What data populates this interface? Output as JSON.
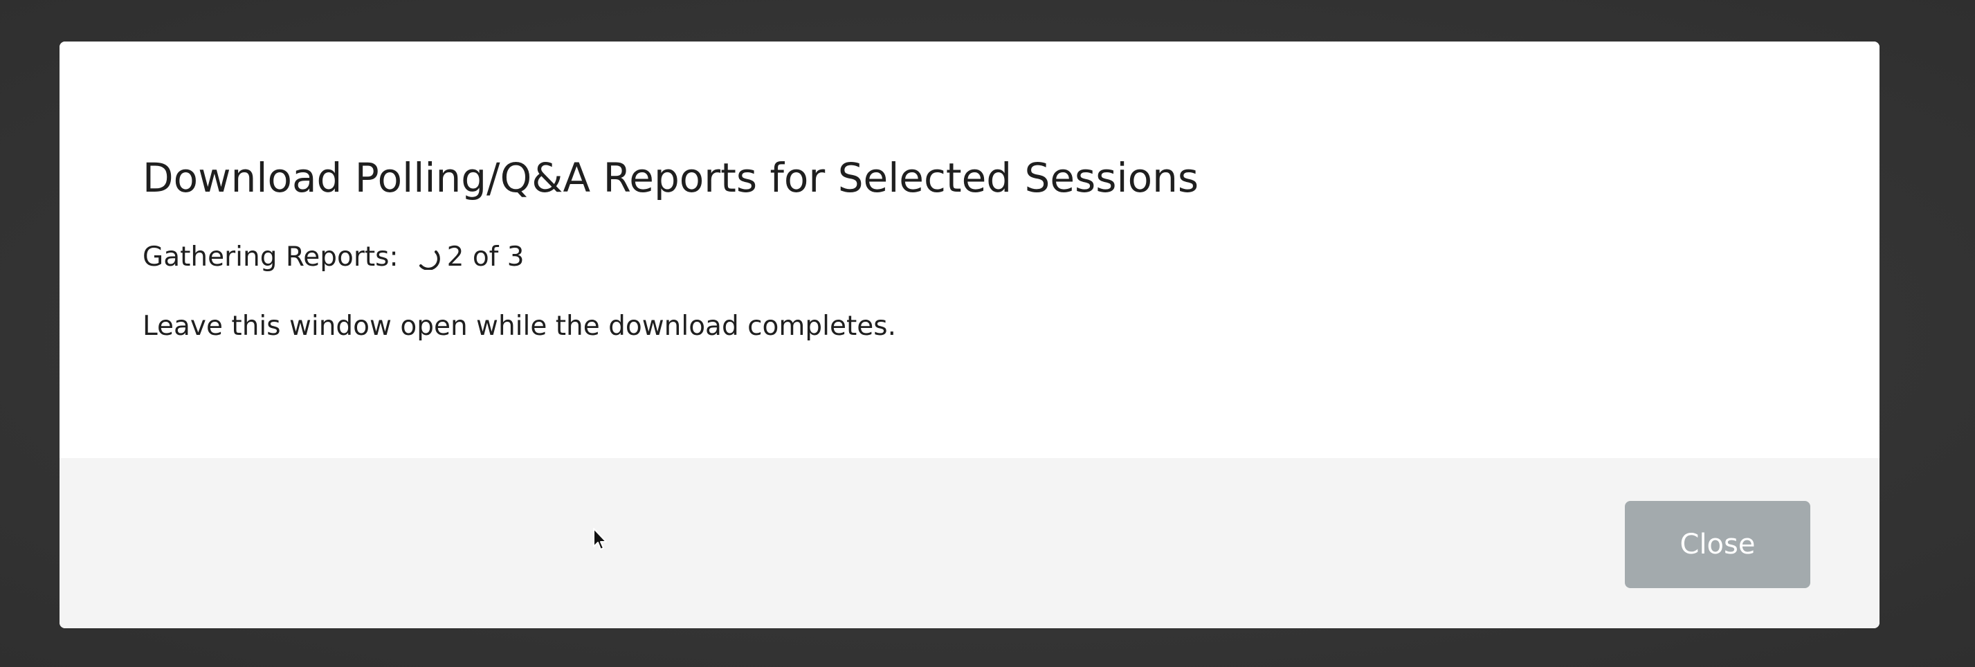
{
  "dialog": {
    "title": "Download Polling/Q&A Reports for Selected Sessions",
    "status_label": "Gathering Reports:",
    "progress_text": "2 of 3",
    "progress": {
      "current": 2,
      "total": 3
    },
    "notice": "Leave this window open while the download completes.",
    "close_label": "Close",
    "spinner_icon": "spinner-icon"
  },
  "colors": {
    "backdrop": "#353535",
    "modal_bg": "#ffffff",
    "footer_bg": "#f4f4f4",
    "close_button_bg": "#a3aaad",
    "text": "#1f1f1f"
  }
}
